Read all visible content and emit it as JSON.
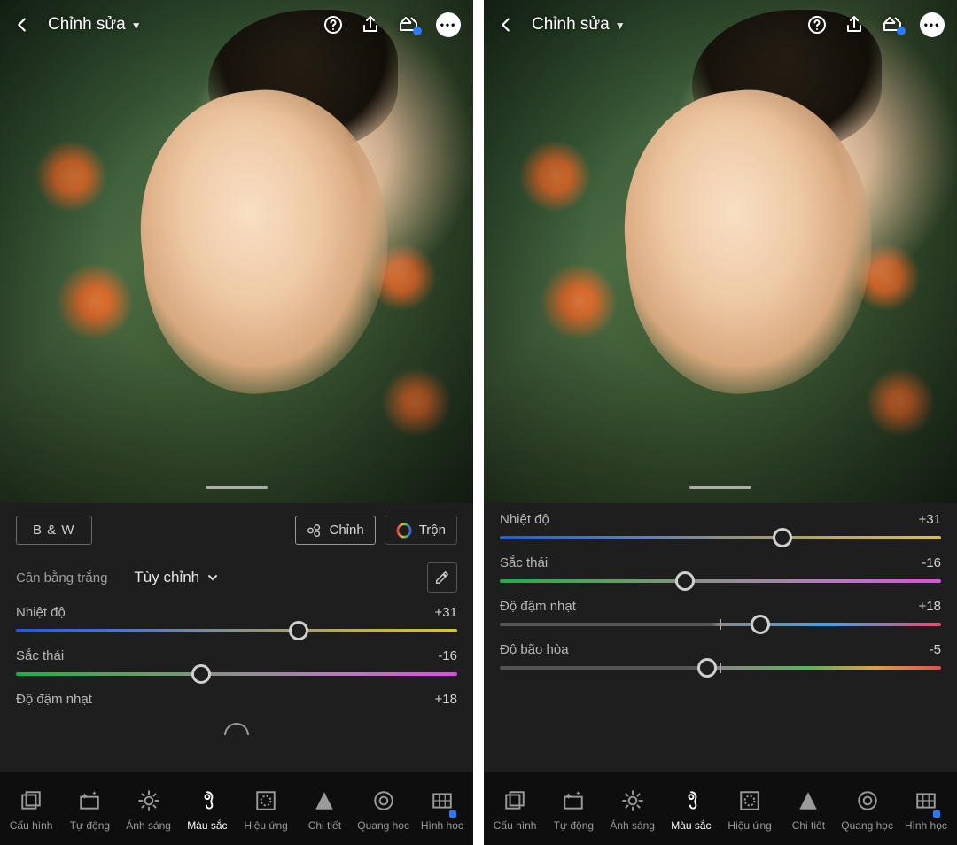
{
  "header": {
    "title": "Chỉnh sửa"
  },
  "left": {
    "bw": "B & W",
    "chinh": "Chỉnh",
    "tron": "Trộn",
    "wb_label": "Cân bằng trắng",
    "wb_value": "Tùy chỉnh",
    "sliders": [
      {
        "name": "Nhiệt độ",
        "value": "+31",
        "pos": 64,
        "kind": "temp"
      },
      {
        "name": "Sắc thái",
        "value": "-16",
        "pos": 42,
        "kind": "tint"
      },
      {
        "name": "Độ đậm nhạt",
        "value": "+18",
        "pos": null,
        "kind": "vib"
      }
    ]
  },
  "right": {
    "sliders": [
      {
        "name": "Nhiệt độ",
        "value": "+31",
        "pos": 64,
        "kind": "temp"
      },
      {
        "name": "Sắc thái",
        "value": "-16",
        "pos": 42,
        "kind": "tint"
      },
      {
        "name": "Độ đậm nhạt",
        "value": "+18",
        "pos": 59,
        "kind": "vib"
      },
      {
        "name": "Độ bão hòa",
        "value": "-5",
        "pos": 47,
        "kind": "sat"
      }
    ]
  },
  "nav": [
    {
      "key": "cau-hinh",
      "label": "Cấu hình",
      "icon": "profiles"
    },
    {
      "key": "tu-dong",
      "label": "Tự động",
      "icon": "auto"
    },
    {
      "key": "anh-sang",
      "label": "Ánh sáng",
      "icon": "light"
    },
    {
      "key": "mau-sac",
      "label": "Màu sắc",
      "icon": "color",
      "active": true
    },
    {
      "key": "hieu-ung",
      "label": "Hiệu ứng",
      "icon": "effects"
    },
    {
      "key": "chi-tiet",
      "label": "Chi tiết",
      "icon": "detail"
    },
    {
      "key": "quang-hoc",
      "label": "Quang học",
      "icon": "optics"
    },
    {
      "key": "hinh-hoc",
      "label": "Hình học",
      "icon": "geometry"
    }
  ]
}
